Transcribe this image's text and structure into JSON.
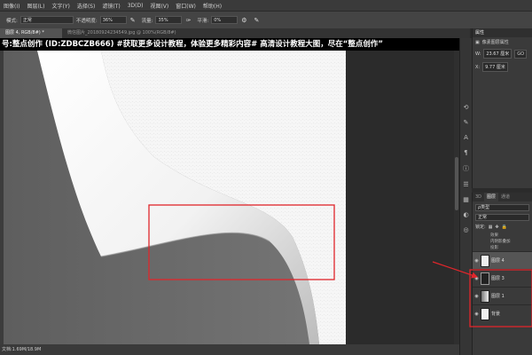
{
  "menu": [
    "图像(I)",
    "图层(L)",
    "文字(Y)",
    "选择(S)",
    "滤镜(T)",
    "3D(D)",
    "视图(V)",
    "窗口(W)",
    "帮助(H)"
  ],
  "options": {
    "mode_label": "模式:",
    "mode_value": "正常",
    "opacity_label": "不透明度:",
    "opacity_value": "36%",
    "flow_label": "流量:",
    "flow_value": "35%",
    "smooth_label": "平滑:",
    "smooth_value": "0%"
  },
  "tabs": {
    "active": "图层 4, RGB/8#) *",
    "inactive": "微信图片_20180924234549.jpg @ 100%(RGB/8#)"
  },
  "banner": "号:整点创作 (ID:ZDBCZB666) #获取更多设计教程，体验更多精彩内容# 高清设计教程大图，尽在“整点创作”",
  "status": "文档:1.69M/18.9M",
  "properties": {
    "title": "属性",
    "subtitle": "像素图层属性",
    "w_label": "W:",
    "w_value": "23.67 厘米",
    "go_label": "GO",
    "x_label": "X:",
    "x_value": "9.77 厘米"
  },
  "layers_panel": {
    "tabs": [
      "3D",
      "图层",
      "通道"
    ],
    "filter": "ρ类型",
    "blend": "正常",
    "lock_label": "锁定:",
    "effects_label": "效果",
    "effect_items": [
      "内阴影叠加",
      "投影"
    ],
    "layers": [
      {
        "name": "图层 4",
        "active": true
      },
      {
        "name": "图层 3",
        "active": false
      },
      {
        "name": "图层 1",
        "active": false
      },
      {
        "name": "背景",
        "active": false
      }
    ]
  },
  "colors": {
    "annotation_red": "#e0262b",
    "canvas_gray": "#6c6c6c",
    "paper_white": "#f7f7f7"
  }
}
